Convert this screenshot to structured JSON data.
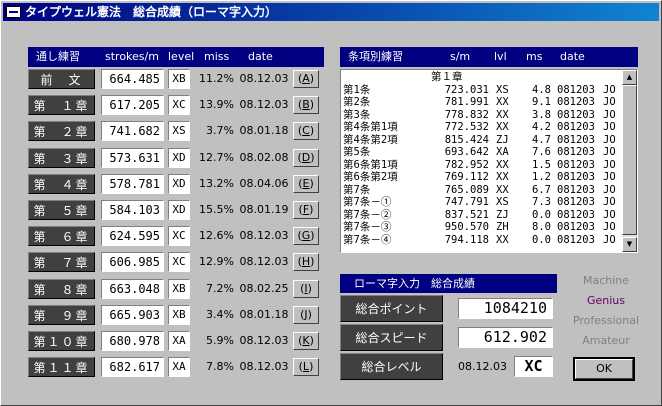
{
  "window": {
    "title": "タイプウェル憲法　総合成績（ローマ字入力）"
  },
  "left": {
    "headers": {
      "section": "通し練習",
      "strokes": "strokes/m",
      "level": "level",
      "miss": "miss",
      "date": "date"
    },
    "rows": [
      {
        "chapter": "前　文",
        "strokes": "664.485",
        "level": "XB",
        "miss": "11.2%",
        "date": "08.12.03",
        "key": "A"
      },
      {
        "chapter": "第　１章",
        "strokes": "617.205",
        "level": "XC",
        "miss": "13.9%",
        "date": "08.12.03",
        "key": "B"
      },
      {
        "chapter": "第　２章",
        "strokes": "741.682",
        "level": "XS",
        "miss": "3.7%",
        "date": "08.01.18",
        "key": "C"
      },
      {
        "chapter": "第　３章",
        "strokes": "573.631",
        "level": "XD",
        "miss": "12.7%",
        "date": "08.02.08",
        "key": "D"
      },
      {
        "chapter": "第　４章",
        "strokes": "578.781",
        "level": "XD",
        "miss": "13.2%",
        "date": "08.04.06",
        "key": "E"
      },
      {
        "chapter": "第　５章",
        "strokes": "584.103",
        "level": "XD",
        "miss": "15.5%",
        "date": "08.01.19",
        "key": "F"
      },
      {
        "chapter": "第　６章",
        "strokes": "624.595",
        "level": "XC",
        "miss": "12.6%",
        "date": "08.12.03",
        "key": "G"
      },
      {
        "chapter": "第　７章",
        "strokes": "606.985",
        "level": "XC",
        "miss": "12.9%",
        "date": "08.12.03",
        "key": "H"
      },
      {
        "chapter": "第　８章",
        "strokes": "663.048",
        "level": "XB",
        "miss": "7.2%",
        "date": "08.02.25",
        "key": "I"
      },
      {
        "chapter": "第　９章",
        "strokes": "665.903",
        "level": "XB",
        "miss": "3.4%",
        "date": "08.01.18",
        "key": "J"
      },
      {
        "chapter": "第１０章",
        "strokes": "680.978",
        "level": "XA",
        "miss": "5.9%",
        "date": "08.12.03",
        "key": "K"
      },
      {
        "chapter": "第１１章",
        "strokes": "682.617",
        "level": "XA",
        "miss": "7.8%",
        "date": "08.12.03",
        "key": "L"
      }
    ]
  },
  "right": {
    "headers": {
      "section": "条項別練習",
      "sm": "s/m",
      "lvl": "lvl",
      "ms": "ms",
      "date": "date"
    },
    "heading": "第１章",
    "items": [
      {
        "name": "第1条",
        "sm": "723.031",
        "lvl": "XS",
        "ms": "4.8",
        "date": "081203",
        "mode": "JO"
      },
      {
        "name": "第2条",
        "sm": "781.991",
        "lvl": "XX",
        "ms": "9.1",
        "date": "081203",
        "mode": "JO"
      },
      {
        "name": "第3条",
        "sm": "778.832",
        "lvl": "XX",
        "ms": "3.8",
        "date": "081203",
        "mode": "JO"
      },
      {
        "name": "第4条第1項",
        "sm": "772.532",
        "lvl": "XX",
        "ms": "4.2",
        "date": "081203",
        "mode": "JO"
      },
      {
        "name": "第4条第2項",
        "sm": "815.424",
        "lvl": "ZJ",
        "ms": "4.7",
        "date": "081203",
        "mode": "JO"
      },
      {
        "name": "第5条",
        "sm": "693.642",
        "lvl": "XA",
        "ms": "7.6",
        "date": "081203",
        "mode": "JO"
      },
      {
        "name": "第6条第1項",
        "sm": "782.952",
        "lvl": "XX",
        "ms": "1.5",
        "date": "081203",
        "mode": "JO"
      },
      {
        "name": "第6条第2項",
        "sm": "769.112",
        "lvl": "XX",
        "ms": "1.2",
        "date": "081203",
        "mode": "JO"
      },
      {
        "name": "第7条",
        "sm": "765.089",
        "lvl": "XX",
        "ms": "6.7",
        "date": "081203",
        "mode": "JO"
      },
      {
        "name": "第7条－①",
        "sm": "747.791",
        "lvl": "XS",
        "ms": "7.3",
        "date": "081203",
        "mode": "JO"
      },
      {
        "name": "第7条－②",
        "sm": "837.521",
        "lvl": "ZJ",
        "ms": "0.0",
        "date": "081203",
        "mode": "JO"
      },
      {
        "name": "第7条－③",
        "sm": "950.570",
        "lvl": "ZH",
        "ms": "8.0",
        "date": "081203",
        "mode": "JO"
      },
      {
        "name": "第7条－④",
        "sm": "794.118",
        "lvl": "XX",
        "ms": "0.0",
        "date": "081203",
        "mode": "JO"
      }
    ]
  },
  "summary": {
    "header": "ローマ字入力　総合成績",
    "points_label": "総合ポイント",
    "points_value": "1084210",
    "speed_label": "総合スピード",
    "speed_value": "612.902",
    "level_label": "総合レベル",
    "level_date": "08.12.03",
    "level_value": "XC"
  },
  "modes": [
    "Machine",
    "Genius",
    "Professional",
    "Amateur"
  ],
  "ok_label": "OK"
}
